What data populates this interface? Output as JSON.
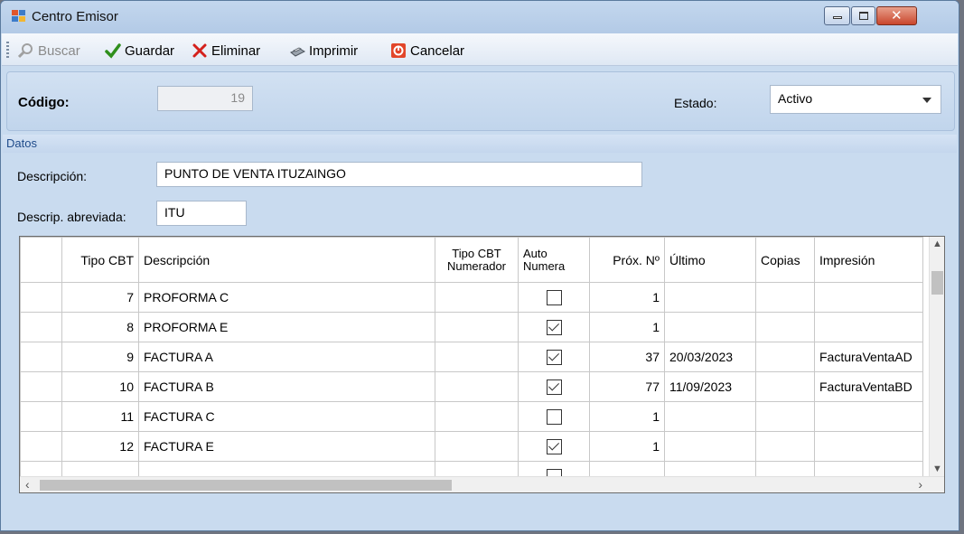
{
  "window": {
    "title": "Centro Emisor",
    "close_glyph": "✕"
  },
  "toolbar": {
    "buscar": "Buscar",
    "guardar": "Guardar",
    "eliminar": "Eliminar",
    "imprimir": "Imprimir",
    "cancelar": "Cancelar",
    "icons": [
      "search-icon",
      "checkmark-icon",
      "delete-x-icon",
      "printer-icon",
      "cancel-icon"
    ]
  },
  "header": {
    "codigo_label": "Código:",
    "codigo_value": "19",
    "estado_label": "Estado:",
    "estado_value": "Activo"
  },
  "datos": {
    "section_label": "Datos",
    "descripcion_label": "Descripción:",
    "descripcion_value": "PUNTO DE VENTA ITUZAINGO",
    "abreviada_label": "Descrip. abreviada:",
    "abreviada_value": "ITU"
  },
  "grid": {
    "columns": {
      "tipo_cbt": "Tipo CBT",
      "descripcion": "Descripción",
      "tipo_num_1": "Tipo CBT",
      "tipo_num_2": "Numerador",
      "auto_1": "Auto",
      "auto_2": "Numera",
      "prox": "Próx. Nº",
      "ultimo": "Último",
      "copias": "Copias",
      "impresion": "Impresión"
    },
    "rows": [
      {
        "tipo": "7",
        "desc": "PROFORMA C",
        "auto": false,
        "prox": "1",
        "ultimo": "",
        "imp": ""
      },
      {
        "tipo": "8",
        "desc": "PROFORMA E",
        "auto": true,
        "prox": "1",
        "ultimo": "",
        "imp": ""
      },
      {
        "tipo": "9",
        "desc": "FACTURA A",
        "auto": true,
        "prox": "37",
        "ultimo": "20/03/2023",
        "imp": "FacturaVentaAD"
      },
      {
        "tipo": "10",
        "desc": "FACTURA B",
        "auto": true,
        "prox": "77",
        "ultimo": "11/09/2023",
        "imp": "FacturaVentaBD"
      },
      {
        "tipo": "11",
        "desc": "FACTURA C",
        "auto": false,
        "prox": "1",
        "ultimo": "",
        "imp": ""
      },
      {
        "tipo": "12",
        "desc": "FACTURA E",
        "auto": true,
        "prox": "1",
        "ultimo": "",
        "imp": ""
      }
    ]
  }
}
